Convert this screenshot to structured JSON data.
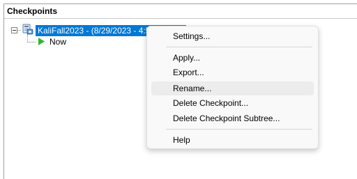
{
  "panel": {
    "title": "Checkpoints"
  },
  "tree": {
    "root": {
      "label": "KaliFall2023 - (8/29/2023 - 4:50:14 PM)",
      "icon": "vm-checkpoint-icon"
    },
    "child": {
      "label": "Now",
      "icon": "play-icon"
    }
  },
  "menu": {
    "settings": "Settings...",
    "apply": "Apply...",
    "export": "Export...",
    "rename": "Rename...",
    "delete_checkpoint": "Delete Checkpoint...",
    "delete_subtree": "Delete Checkpoint Subtree...",
    "help": "Help"
  },
  "colors": {
    "selection": "#0078d7",
    "now_arrow": "#2db82d",
    "menu_hover": "#ececec"
  }
}
